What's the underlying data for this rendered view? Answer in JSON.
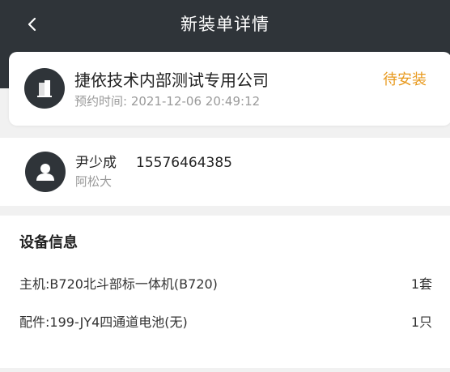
{
  "header": {
    "title": "新装单详情",
    "back_icon": "chevron-left-icon"
  },
  "order": {
    "company_name": "捷依技术内部测试专用公司",
    "appointment_label": "预约时间:",
    "appointment_time": "2021-12-06 20:49:12",
    "status": "待安装",
    "status_color": "#e89a1f",
    "avatar_icon": "building-icon"
  },
  "contact": {
    "name": "尹少成",
    "phone": "15576464385",
    "sub_text": "阿松大",
    "avatar_icon": "user-icon"
  },
  "devices": {
    "title": "设备信息",
    "items": [
      {
        "label": "主机:",
        "name": "B720北斗部标一体机(B720)",
        "qty": "1套"
      },
      {
        "label": "配件:",
        "name": "199-JY4四通道电池(无)",
        "qty": "1只"
      }
    ]
  },
  "colors": {
    "header_bg": "#2f3439",
    "page_bg": "#f1f1f1",
    "accent": "#e89a1f"
  }
}
